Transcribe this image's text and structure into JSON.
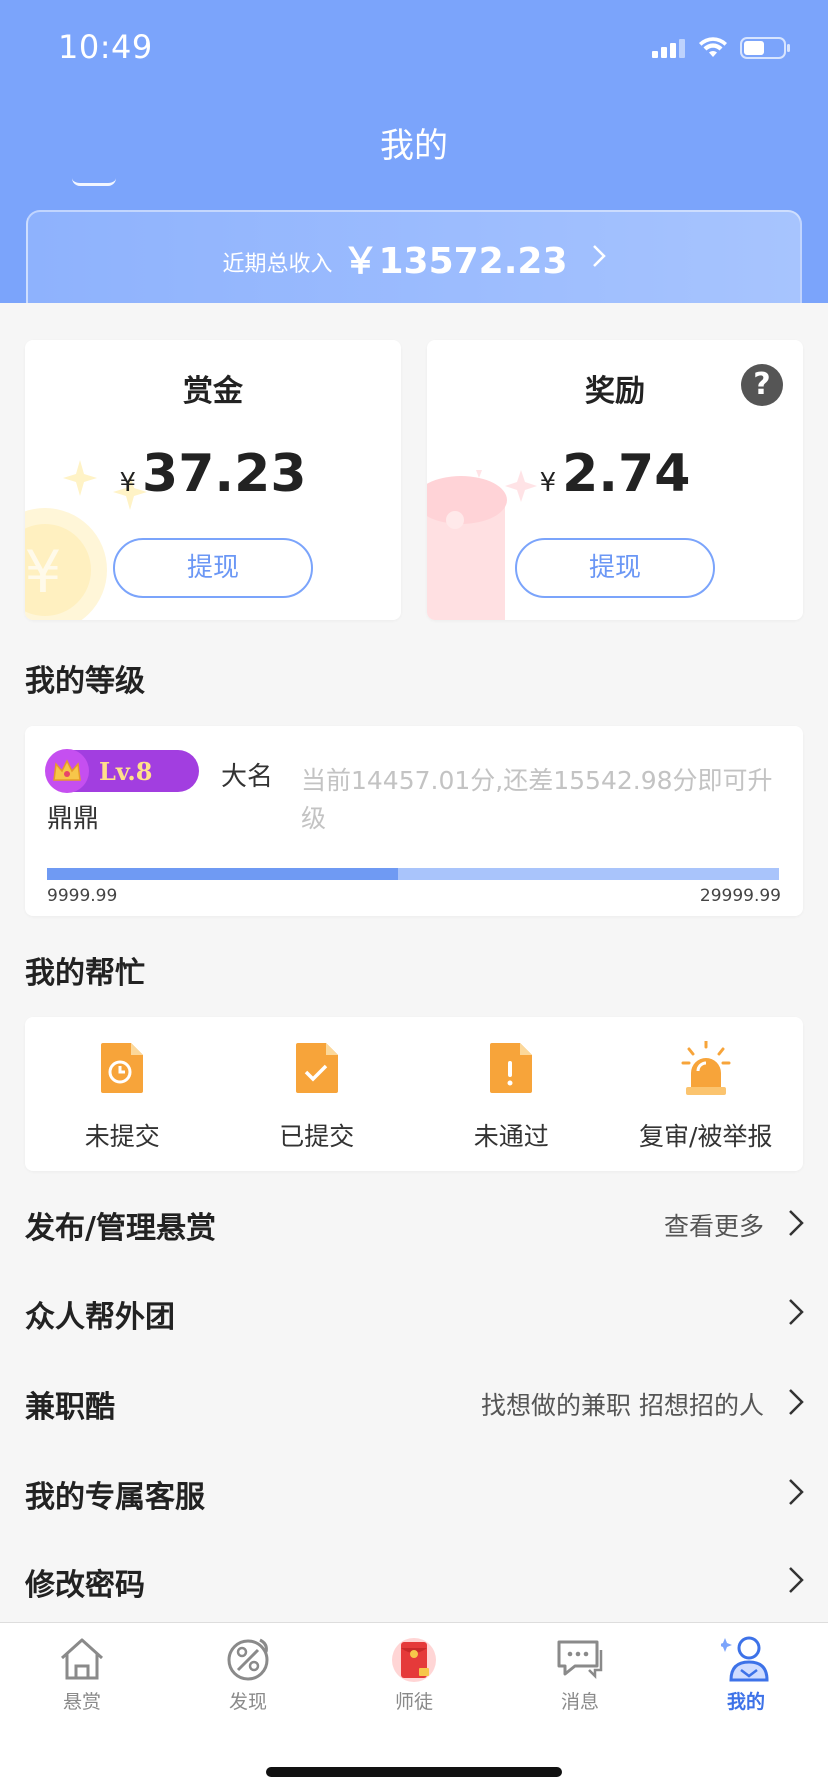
{
  "status_bar": {
    "time": "10:49"
  },
  "header": {
    "title": "我的",
    "income_label": "近期总收入",
    "income_value": "￥13572.23"
  },
  "bounty_card": {
    "title": "赏金",
    "currency": "¥",
    "amount": "37.23",
    "button": "提现"
  },
  "reward_card": {
    "title": "奖励",
    "currency": "¥",
    "amount": "2.74",
    "button": "提现",
    "help": "?"
  },
  "level_section": {
    "title": "我的等级",
    "level": "Lv.8",
    "name": "大名鼎鼎",
    "description": "当前14457.01分,还差15542.98分即可升级",
    "min": "9999.99",
    "max": "29999.99",
    "progress_fraction": 0.48
  },
  "help_section": {
    "title": "我的帮忙",
    "items": [
      {
        "label": "未提交",
        "icon": "pending-doc-icon"
      },
      {
        "label": "已提交",
        "icon": "submitted-doc-icon"
      },
      {
        "label": "未通过",
        "icon": "rejected-doc-icon"
      },
      {
        "label": "复审/被举报",
        "icon": "alarm-icon"
      }
    ]
  },
  "menu": [
    {
      "title": "发布/管理悬赏",
      "hint": "查看更多"
    },
    {
      "title": "众人帮外团",
      "hint": ""
    },
    {
      "title": "兼职酷",
      "hint": "找想做的兼职 招想招的人"
    },
    {
      "title": "我的专属客服",
      "hint": ""
    },
    {
      "title": "修改密码",
      "hint": ""
    }
  ],
  "tabbar": {
    "items": [
      {
        "label": "悬赏",
        "icon": "home-icon"
      },
      {
        "label": "发现",
        "icon": "discover-icon"
      },
      {
        "label": "师徒",
        "icon": "red-envelope-icon"
      },
      {
        "label": "消息",
        "icon": "message-icon"
      },
      {
        "label": "我的",
        "icon": "profile-icon",
        "active": true
      }
    ]
  },
  "colors": {
    "header_blue": "#7ba4fb",
    "accent_blue": "#3d72e8",
    "orange": "#f7a43a",
    "level_purple": "#a23ee0"
  }
}
